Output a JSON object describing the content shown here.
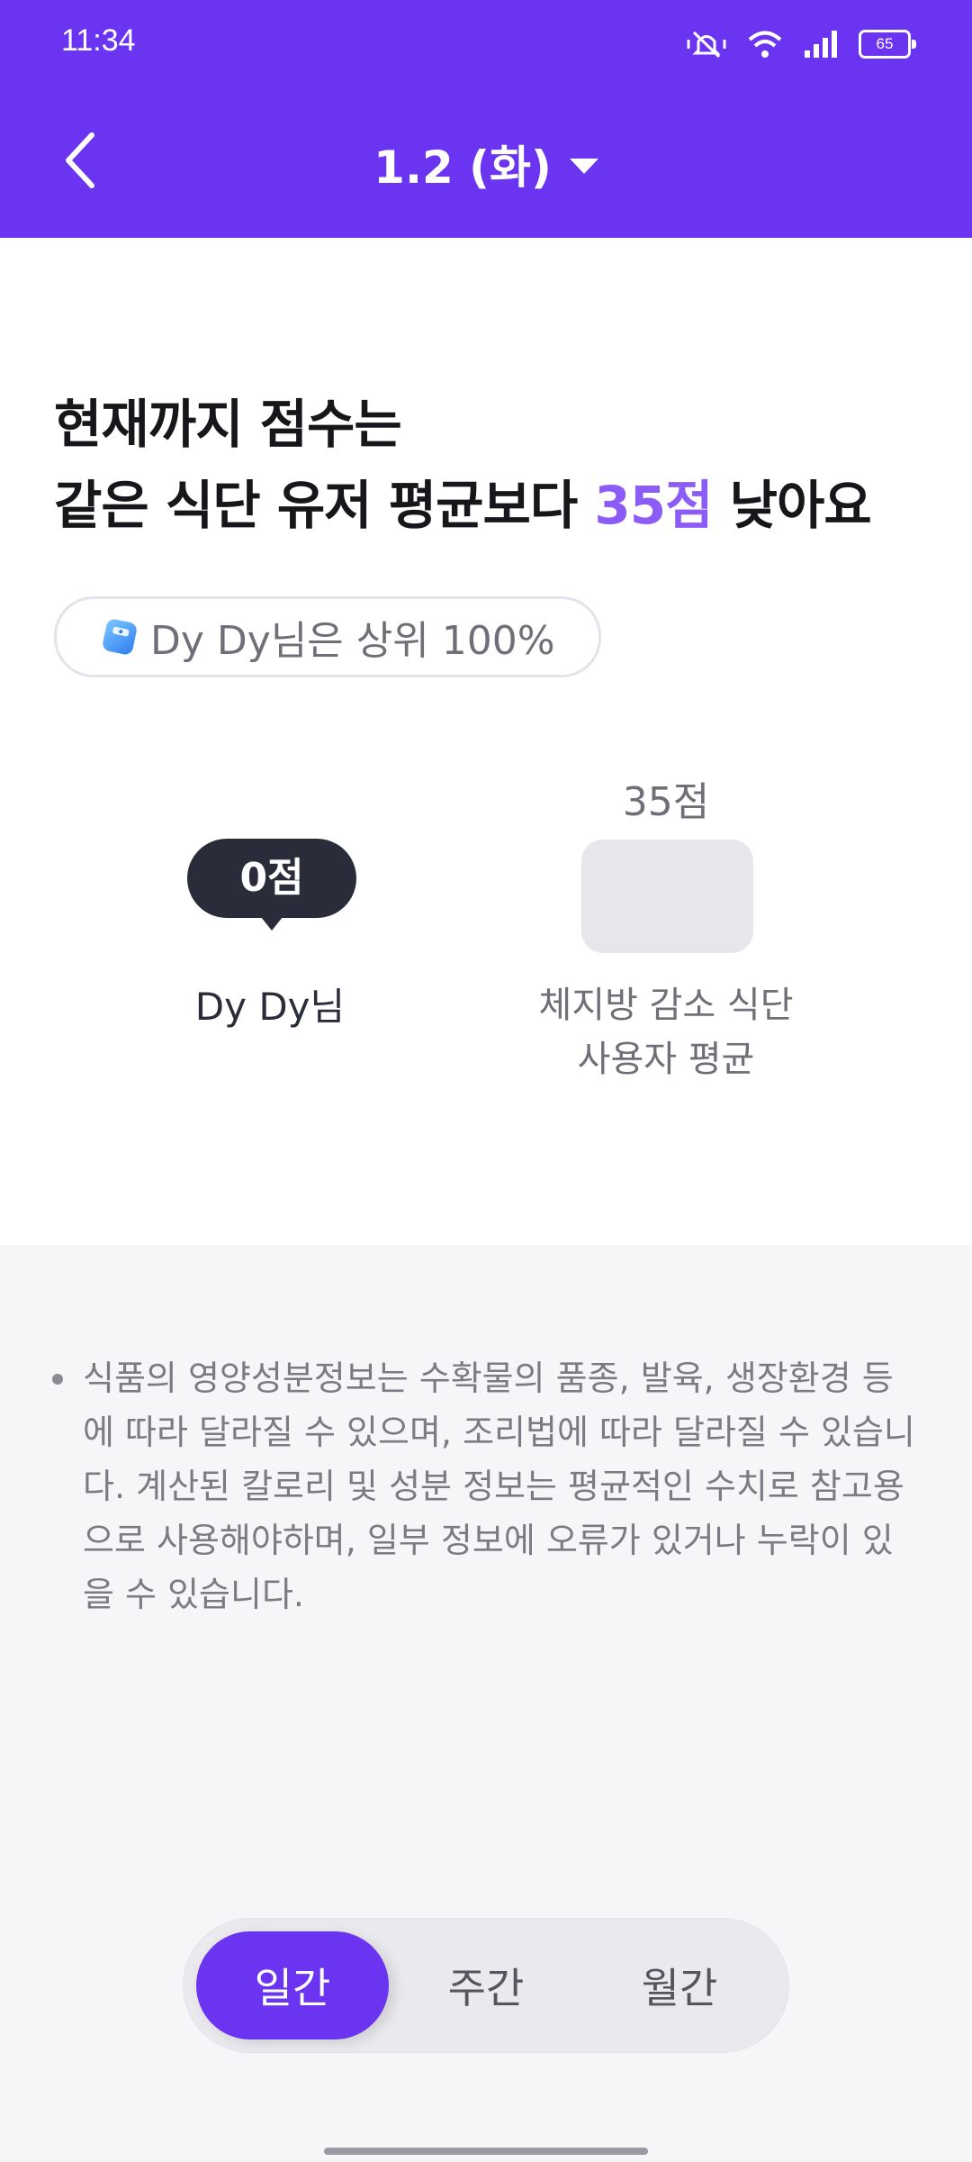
{
  "status_bar": {
    "time": "11:34",
    "battery": "65"
  },
  "header": {
    "date_label": "1.2 (화)"
  },
  "summary": {
    "headline_line1": "현재까지 점수는",
    "headline_line2_pre": "같은 식단 유저 평균보다 ",
    "headline_line2_accent": "35점",
    "headline_line2_post": " 낮아요",
    "rank_text": "Dy Dy님은 상위 100%"
  },
  "chart_data": {
    "type": "bar",
    "categories": [
      "Dy Dy님",
      "체지방 감소 식단 사용자 평균"
    ],
    "values": [
      0,
      35
    ],
    "value_labels": [
      "0점",
      "35점"
    ]
  },
  "comparison": {
    "user_score_label": "0점",
    "user_name": "Dy Dy님",
    "avg_score_label": "35점",
    "avg_label_line1": "체지방 감소 식단",
    "avg_label_line2": "사용자 평균"
  },
  "notice": {
    "text": "식품의 영양성분정보는 수확물의 품종, 발육, 생장환경 등에 따라 달라질 수 있으며, 조리법에 따라 달라질 수 있습니다. 계산된 칼로리 및 성분 정보는 평균적인 수치로 참고용으로 사용해야하며, 일부 정보에 오류가 있거나 누락이 있을 수 있습니다."
  },
  "period_tabs": [
    "일간",
    "주간",
    "월간"
  ],
  "colors": {
    "brand": "#6b34f0",
    "accent": "#8b5cf6",
    "bubble": "#2b2c3a"
  },
  "icons": {
    "back": "chevron-left-icon",
    "dropdown": "caret-down-icon",
    "rank": "scale-icon"
  }
}
